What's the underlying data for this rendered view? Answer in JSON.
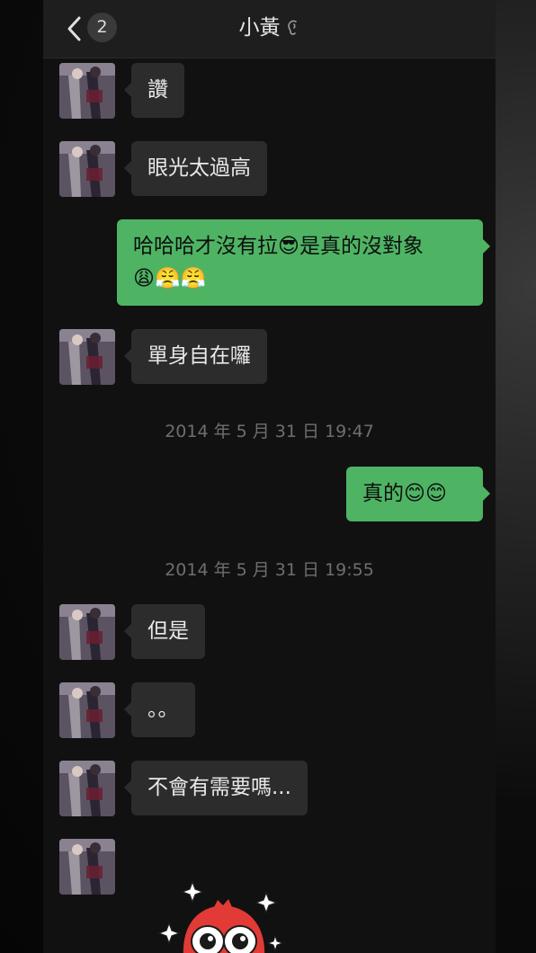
{
  "header": {
    "unread_count": "2",
    "title": "小黃"
  },
  "messages": [
    {
      "side": "in",
      "text": "讚"
    },
    {
      "side": "in",
      "text": "眼光太過高"
    },
    {
      "side": "out",
      "text": "哈哈哈才沒有拉😎是真的沒對象\n😩😤😤"
    },
    {
      "side": "in",
      "text": "單身自在囉"
    },
    {
      "side": "time",
      "text": "2014 年 5 月 31 日 19:47"
    },
    {
      "side": "out",
      "text": "真的😊😊"
    },
    {
      "side": "time",
      "text": "2014 年 5 月 31 日 19:55"
    },
    {
      "side": "in",
      "text": "但是"
    },
    {
      "side": "in",
      "text": "。。"
    },
    {
      "side": "in",
      "text": "不會有需要嗎..."
    }
  ],
  "colors": {
    "outgoing_bubble": "#4eb464",
    "incoming_bubble": "#2c2c2c",
    "background": "#111111"
  }
}
